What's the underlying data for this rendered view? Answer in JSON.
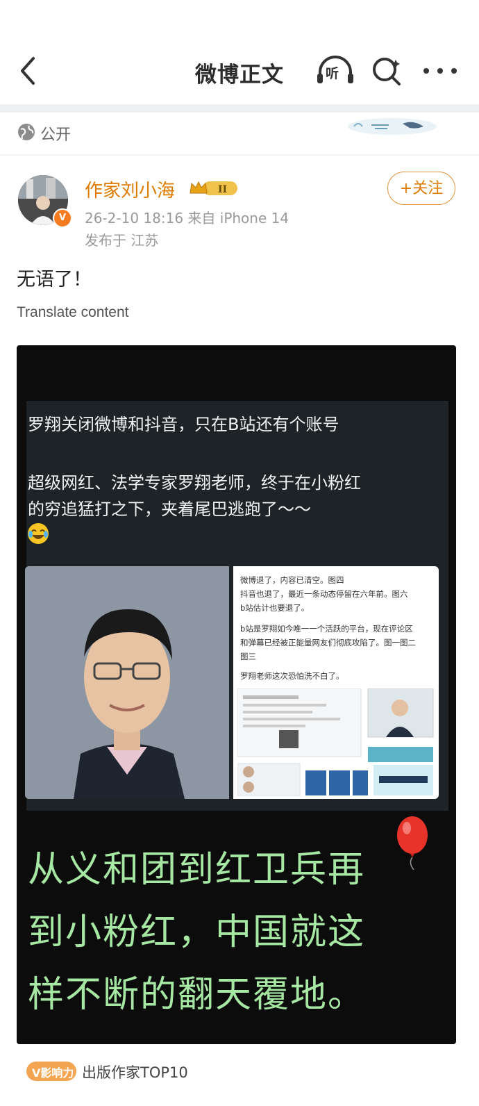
{
  "header": {
    "title": "微博正文",
    "listen_label": "听"
  },
  "visibility": {
    "label": "公开"
  },
  "author": {
    "name": "作家刘小海",
    "level_badge": "II",
    "timestamp_source": "26-2-10 18:16   来自 iPhone 14",
    "location": "发布于 江苏",
    "follow_label": "+关注",
    "verified_badge": "V"
  },
  "post": {
    "text": "无语了！",
    "translate_label": "Translate content"
  },
  "image": {
    "headline": "罗翔关闭微博和抖音，只在B站还有个账号",
    "sub_line1": "超级网红、法学专家罗翔老师，终于在小粉红",
    "sub_line2": "的穷追猛打之下，夹着尾巴逃跑了～～",
    "screenshot_lines": [
      "微博退了，内容已清空。图四",
      "抖音也退了，最近一条动态停留在六年前。图六",
      "b站估计也要退了。",
      "b站是罗翔如今唯一一个活跃的平台，现在评论区",
      "和弹幕已经被正能量网友们彻底攻陷了。图一图二",
      "图三",
      "罗翔老师这次恐怕洗不白了。"
    ],
    "caption_line1": "从义和团到红卫兵再",
    "caption_line2": "到小粉红，中国就这",
    "caption_line3": "样不断的翻天覆地。"
  },
  "footer": {
    "influence_badge": "V影响力",
    "influence_label": "出版作家TOP10"
  },
  "colors": {
    "accent": "#e07b00",
    "green_caption": "#a6e8a3"
  }
}
